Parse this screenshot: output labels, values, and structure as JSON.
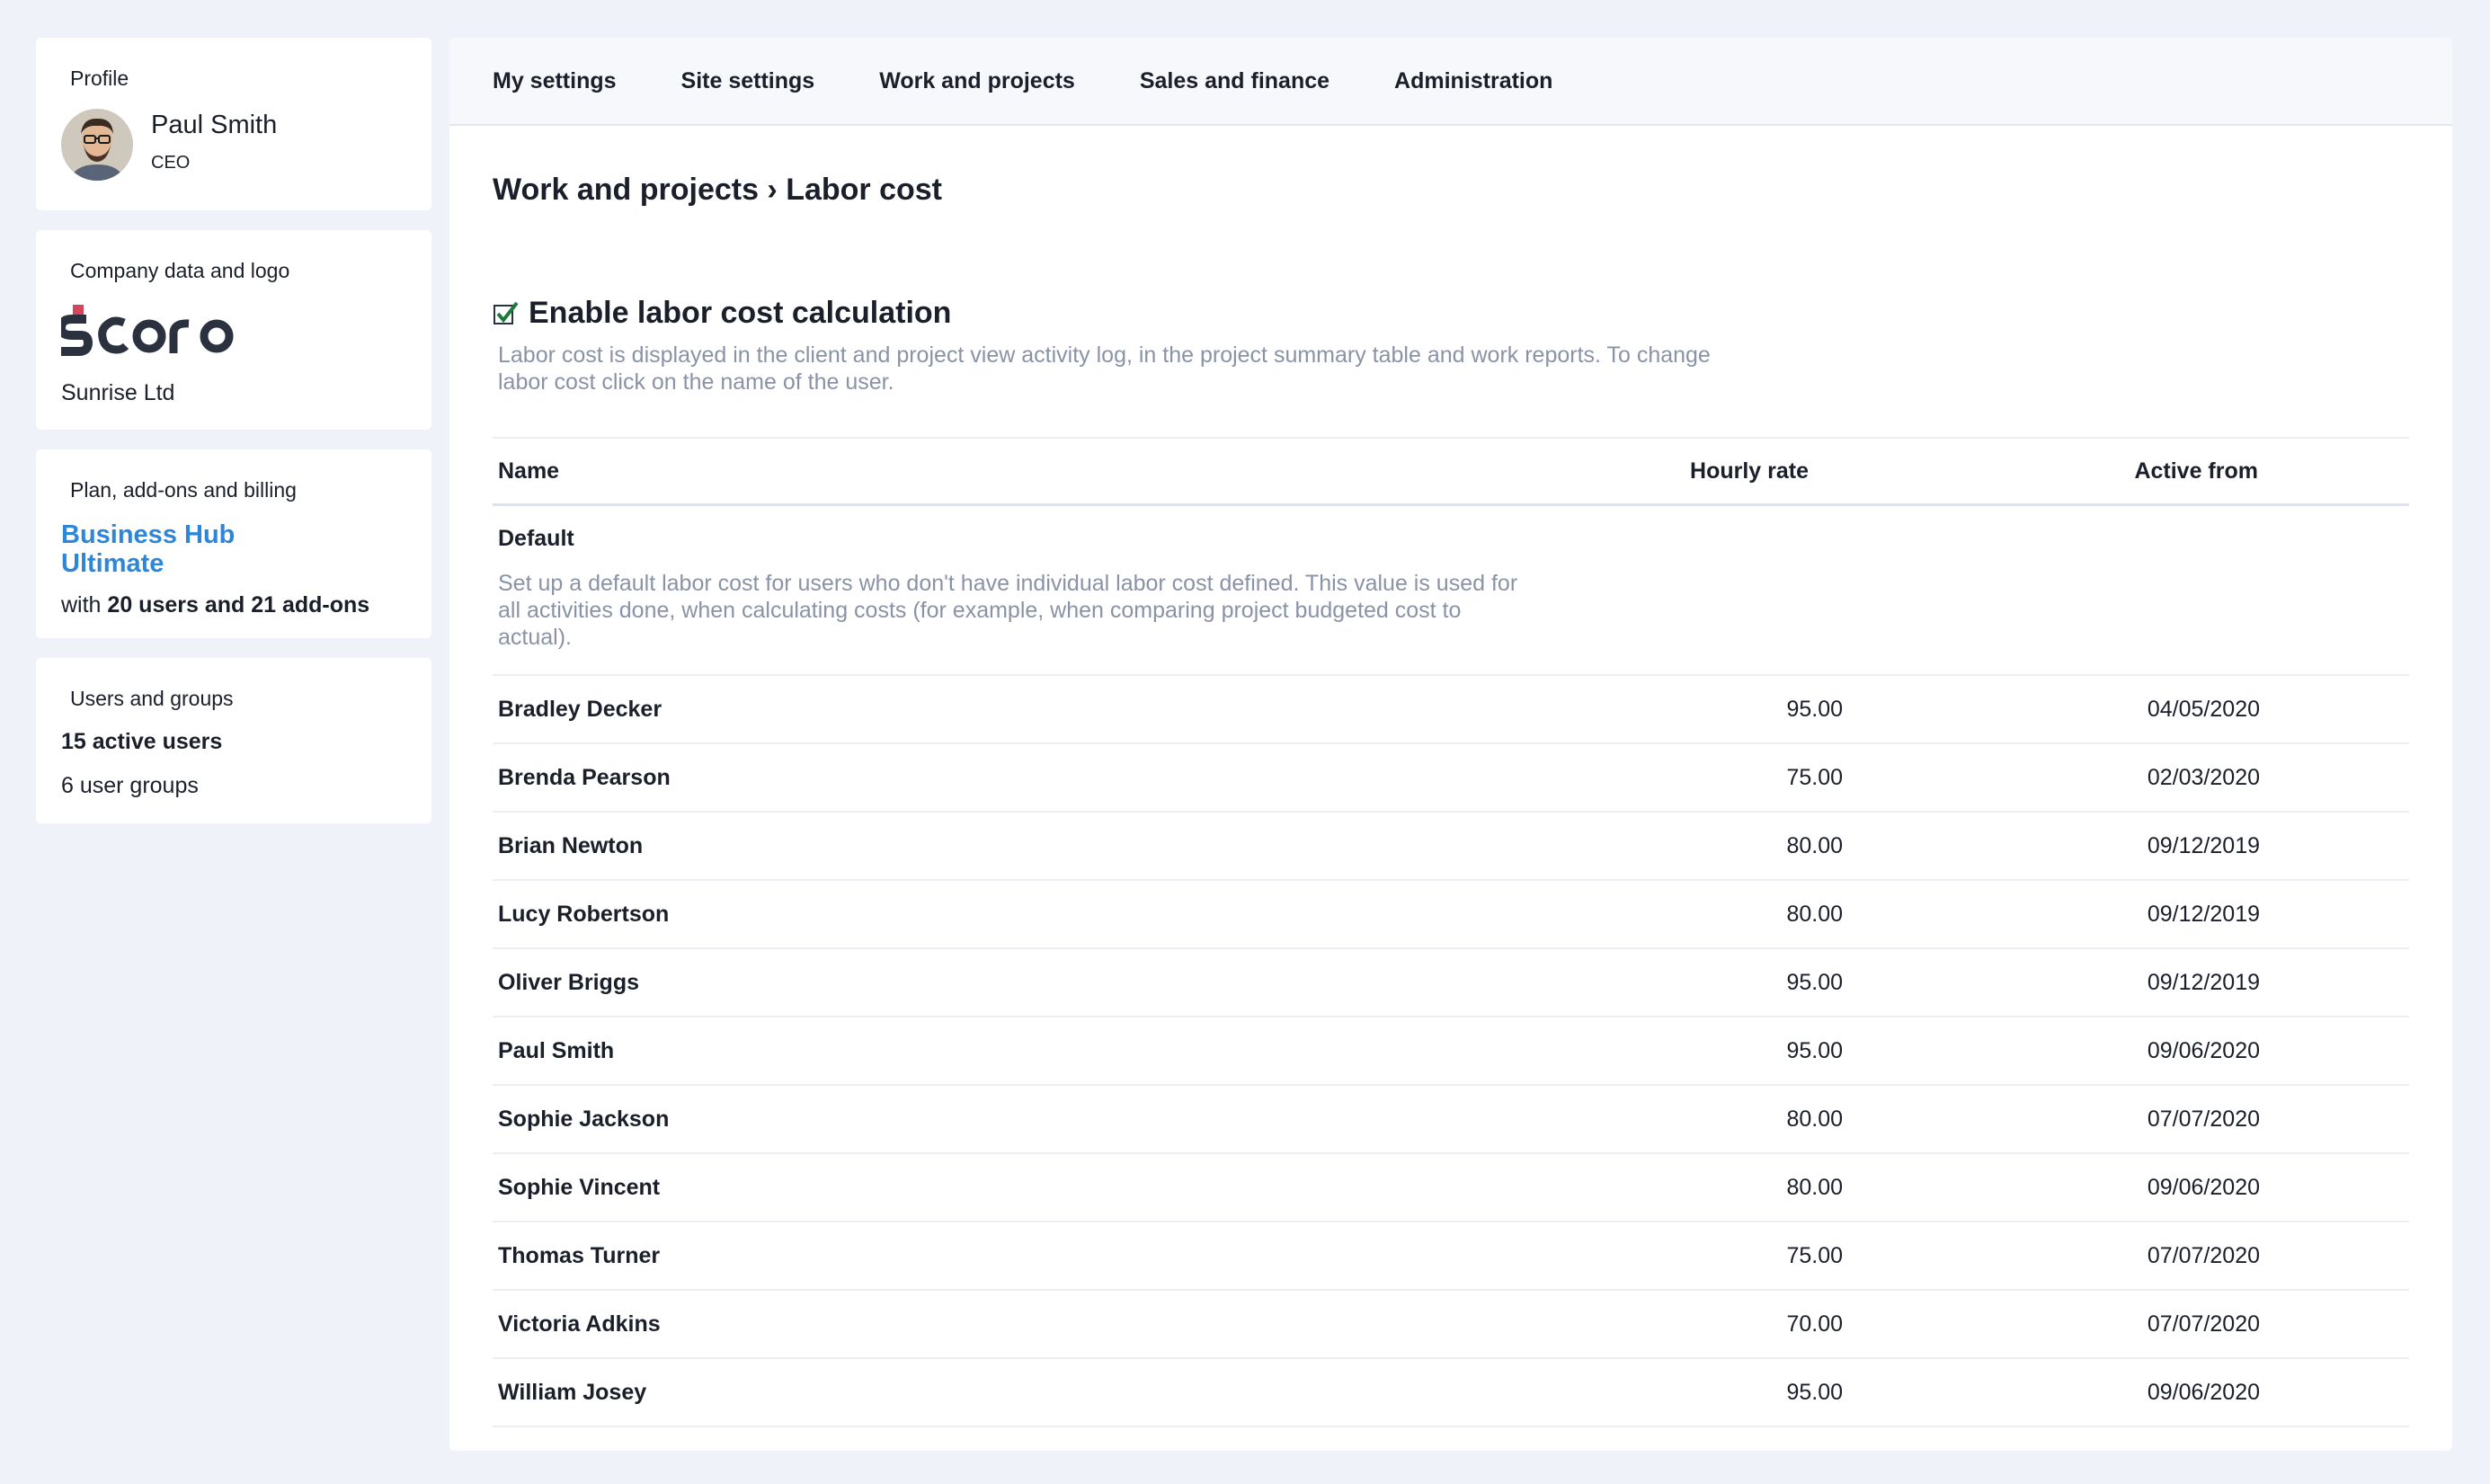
{
  "sidebar": {
    "profile": {
      "title": "Profile",
      "name": "Paul Smith",
      "role": "CEO"
    },
    "company": {
      "title": "Company data and logo",
      "name": "Sunrise Ltd"
    },
    "plan": {
      "title": "Plan, add-ons and billing",
      "name_line1": "Business Hub",
      "name_line2": "Ultimate",
      "detail_prefix": "with",
      "detail_bold": "20 users and 21 add-ons"
    },
    "users": {
      "title": "Users and groups",
      "active": "15 active users",
      "groups": "6 user groups"
    }
  },
  "tabs": [
    {
      "label": "My settings"
    },
    {
      "label": "Site settings"
    },
    {
      "label": "Work and projects"
    },
    {
      "label": "Sales and finance"
    },
    {
      "label": "Administration"
    }
  ],
  "main": {
    "title": "Work and projects › Labor cost",
    "enable_label": "Enable labor cost calculation",
    "enable_checked": true,
    "enable_desc": "Labor cost is displayed in the client and project view activity log, in the project summary table and work reports. To change labor cost click on the name of the user.",
    "table": {
      "headers": {
        "name": "Name",
        "rate": "Hourly rate",
        "date": "Active from"
      },
      "default": {
        "title": "Default",
        "desc": "Set up a default labor cost for users who don't have individual labor cost defined. This value is used for all activities done, when calculating costs (for example, when comparing project budgeted cost to actual)."
      },
      "rows": [
        {
          "name": "Bradley Decker",
          "rate": "95.00",
          "date": "04/05/2020"
        },
        {
          "name": "Brenda Pearson",
          "rate": "75.00",
          "date": "02/03/2020"
        },
        {
          "name": "Brian Newton",
          "rate": "80.00",
          "date": "09/12/2019"
        },
        {
          "name": "Lucy Robertson",
          "rate": "80.00",
          "date": "09/12/2019"
        },
        {
          "name": "Oliver Briggs",
          "rate": "95.00",
          "date": "09/12/2019"
        },
        {
          "name": "Paul Smith",
          "rate": "95.00",
          "date": "09/06/2020"
        },
        {
          "name": "Sophie Jackson",
          "rate": "80.00",
          "date": "07/07/2020"
        },
        {
          "name": "Sophie Vincent",
          "rate": "80.00",
          "date": "09/06/2020"
        },
        {
          "name": "Thomas Turner",
          "rate": "75.00",
          "date": "07/07/2020"
        },
        {
          "name": "Victoria Adkins",
          "rate": "70.00",
          "date": "07/07/2020"
        },
        {
          "name": "William Josey",
          "rate": "95.00",
          "date": "09/06/2020"
        }
      ]
    }
  },
  "colors": {
    "accent": "#2e86d9",
    "check": "#1e7a3c",
    "logo_dark": "#2c3140",
    "logo_red": "#d6455e",
    "muted_text": "#8a93a6"
  }
}
